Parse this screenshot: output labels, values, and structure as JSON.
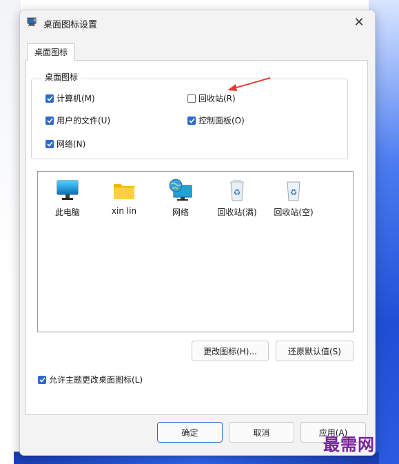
{
  "window": {
    "title": "桌面图标设置"
  },
  "tabs": [
    {
      "label": "桌面图标"
    }
  ],
  "group": {
    "title": "桌面图标",
    "checkboxes": [
      {
        "label": "计算机(M)",
        "checked": true
      },
      {
        "label": "回收站(R)",
        "checked": false
      },
      {
        "label": "用户的文件(U)",
        "checked": true
      },
      {
        "label": "控制面板(O)",
        "checked": true
      },
      {
        "label": "网络(N)",
        "checked": true
      }
    ]
  },
  "icons": [
    {
      "label": "此电脑",
      "icon": "monitor-icon"
    },
    {
      "label": "xin lin",
      "icon": "folder-icon"
    },
    {
      "label": "网络",
      "icon": "network-globe-icon"
    },
    {
      "label": "回收站(满)",
      "icon": "recycle-bin-full-icon"
    },
    {
      "label": "回收站(空)",
      "icon": "recycle-bin-empty-icon"
    }
  ],
  "buttons": {
    "change_icon": "更改图标(H)...",
    "restore_default": "还原默认值(S)",
    "ok": "确定",
    "cancel": "取消",
    "apply": "应用(A)"
  },
  "allow_theme": {
    "label": "允许主题更改桌面图标(L)",
    "checked": true
  },
  "watermark": "最需网",
  "colors": {
    "accent": "#2d6bc8",
    "annotation_arrow": "#e53935"
  }
}
